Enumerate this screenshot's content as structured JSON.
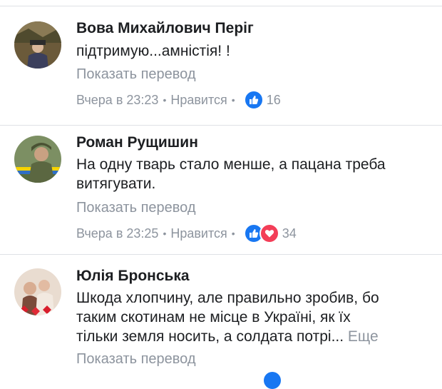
{
  "colors": {
    "like": "#1877f2",
    "love": "#f33e58",
    "meta": "#8d949e",
    "text": "#1c1e21"
  },
  "comments": [
    {
      "author": "Вова Михайлович Періг",
      "text": "підтримую...амністія! !",
      "translate": "Показать перевод",
      "time": "Вчера в 23:23",
      "like": "Нравится",
      "reactions": [
        "like-icon"
      ],
      "count": "16"
    },
    {
      "author": "Роман Рущишин",
      "text_lines": [
        "На одну тварь стало менше, а пацана треба",
        "витягувати."
      ],
      "translate": "Показать перевод",
      "time": "Вчера в 23:25",
      "like": "Нравится",
      "reactions": [
        "like-icon",
        "love-icon"
      ],
      "count": "34"
    },
    {
      "author": "Юлія Бронська",
      "text_lines": [
        "Шкода хлопчину, але правильно зробив, бо",
        "таким скотинам не місце в Україні, як їх",
        "тільки земля носить, а солдата потрі..."
      ],
      "more": "Еще",
      "translate": "Показать перевод"
    }
  ]
}
